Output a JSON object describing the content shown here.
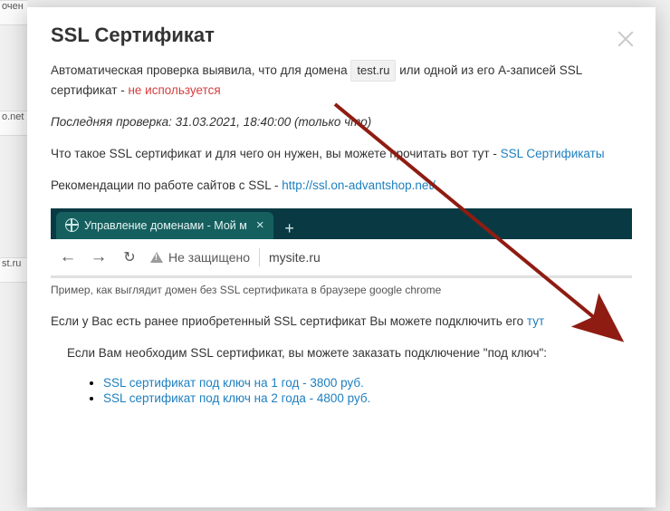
{
  "background": {
    "row1": "очен",
    "row2": "o.net",
    "row3": "st.ru"
  },
  "modal": {
    "title": "SSL Сертификат"
  },
  "intro": {
    "before": "Автоматическая проверка выявила, что для домена",
    "domain": "test.ru",
    "after": "или одной из его A-записей SSL сертификат -",
    "status": "не используется"
  },
  "lastCheck": "Последняя проверка: 31.03.2021, 18:40:00 (только что)",
  "about": {
    "text": "Что такое SSL сертификат и для чего он нужен, вы можете прочитать вот тут -",
    "link": "SSL Сертификаты"
  },
  "reco": {
    "text": "Рекомендации по работе сайтов с SSL -",
    "link": "http://ssl.on-advantshop.net/"
  },
  "browser": {
    "tab_title": "Управление доменами - Мой м",
    "not_secure": "Не защищено",
    "url": "mysite.ru"
  },
  "caption": "Пример, как выглядит домен без SSL сертификата в браузере google chrome",
  "existing": {
    "text": "Если у Вас есть ранее приобретенный SSL сертификат Вы можете подключить его",
    "link": "тут"
  },
  "order": {
    "intro": "Если Вам необходим SSL сертификат, вы можете заказать подключение \"под ключ\":",
    "offers": [
      "SSL сертификат под ключ на 1 год - 3800 руб.",
      "SSL сертификат под ключ на 2 года - 4800 руб."
    ]
  }
}
